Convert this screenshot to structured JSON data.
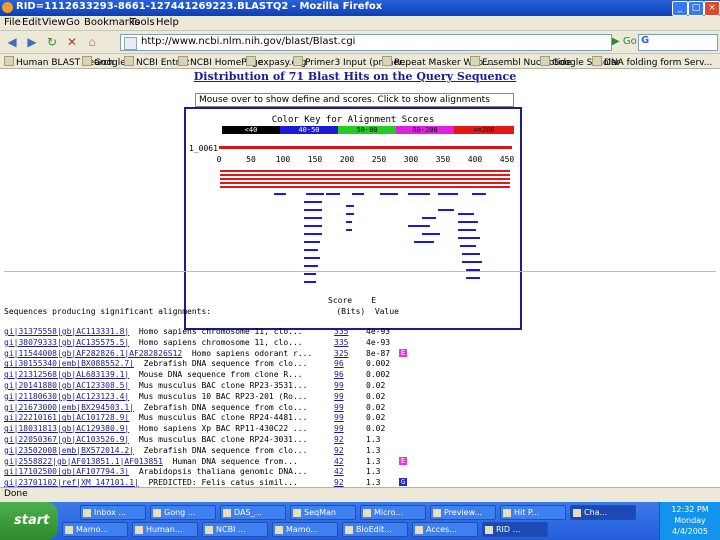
{
  "window": {
    "title": "RID=1112633293-8661-127441269223.BLASTQ2 - Mozilla Firefox",
    "controls": [
      "_",
      "□",
      "×"
    ]
  },
  "menu": [
    "File",
    "Edit",
    "View",
    "Go",
    "Bookmarks",
    "Tools",
    "Help"
  ],
  "nav": {
    "url": "http://www.ncbi.nlm.nih.gov/blast/Blast.cgi",
    "go_label": "Go",
    "search_placeholder": ""
  },
  "bookmarks": [
    "Human BLAST Search",
    "Google",
    "NCBI Entrez",
    "NCBI HomePage",
    "expasy.org",
    "Primer3 Input (primer...",
    "Repeat Masker Web ...",
    "Ensembl Nucleotide",
    "Google Scholar",
    "DNA folding form Serv..."
  ],
  "page": {
    "heading": "Distribution of 71 Blast Hits on the Query Sequence",
    "mouseover_text": "Mouse over to show define and scores. Click to show alignments",
    "key_title": "Color Key for Alignment Scores",
    "key_segments": [
      {
        "label": "<40",
        "color": "#000000"
      },
      {
        "label": "40-50",
        "color": "#1a1ad6"
      },
      {
        "label": "50-80",
        "color": "#22cc22"
      },
      {
        "label": "80-200",
        "color": "#e020e0"
      },
      {
        "label": ">=200",
        "color": "#e01818"
      }
    ],
    "query_label": "1_0061",
    "ticks": [
      "0",
      "50",
      "100",
      "150",
      "200",
      "250",
      "300",
      "350",
      "400",
      "450"
    ]
  },
  "results": {
    "header_line1": "Score    E",
    "header_line2": "Sequences producing significant alignments:                          (Bits)  Value",
    "rows": [
      {
        "acc": "gi|31375558|gb|AC113331.8|",
        "desc": "  Homo sapiens chromosome 11, clo...",
        "score": "335",
        "evalue": "4e-93",
        "badge": ""
      },
      {
        "acc": "gi|38079333|gb|AC135575.5|",
        "desc": "  Homo sapiens chromosome 11, clo...",
        "score": "335",
        "evalue": "4e-93",
        "badge": ""
      },
      {
        "acc": "gi|11544008|gb|AF282826.1|AF282826S12",
        "desc": "  Homo sapiens odorant r...",
        "score": "325",
        "evalue": "8e-87",
        "badge": "pink"
      },
      {
        "acc": "gi|30155340|emb|BX088552.7|",
        "desc": "  Zebrafish DNA sequence from clo...",
        "score": "96",
        "evalue": "0.002",
        "badge": ""
      },
      {
        "acc": "gi|21312568|gb|AL683139.1|",
        "desc": "  Mouse DNA sequence from clone R...",
        "score": "96",
        "evalue": "0.002",
        "badge": ""
      },
      {
        "acc": "gi|20141880|gb|AC123308.5|",
        "desc": "  Mus musculus BAC clone RP23-3531...",
        "score": "99",
        "evalue": "0.02",
        "badge": ""
      },
      {
        "acc": "gi|21180630|gb|AC123123.4|",
        "desc": "  Mus musculus 10 BAC RP23-201 (Ro...",
        "score": "99",
        "evalue": "0.02",
        "badge": ""
      },
      {
        "acc": "gi|21673000|emb|BX294503.1|",
        "desc": "  Zebrafish DNA sequence from clo...",
        "score": "99",
        "evalue": "0.02",
        "badge": ""
      },
      {
        "acc": "gi|22210161|gb|AC101728.9|",
        "desc": "  Mus musculus BAC clone RP24-4481...",
        "score": "99",
        "evalue": "0.02",
        "badge": ""
      },
      {
        "acc": "gi|18031813|gb|AC129380.9|",
        "desc": "  Homo sapiens Xp BAC RP11-430C22 ...",
        "score": "99",
        "evalue": "0.02",
        "badge": ""
      },
      {
        "acc": "gi|22050367|gb|AC103526.9|",
        "desc": "  Mus musculus BAC clone RP24-3031...",
        "score": "92",
        "evalue": "1.3",
        "badge": ""
      },
      {
        "acc": "gi|23502008|emb|BX572014.2|",
        "desc": "  Zebrafish DNA sequence from clo...",
        "score": "92",
        "evalue": "1.3",
        "badge": ""
      },
      {
        "acc": "gi|2558822|gb|AF013851.1|AF013851",
        "desc": "  Human DNA sequence from...",
        "score": "42",
        "evalue": "1.3",
        "badge": "pink"
      },
      {
        "acc": "gi|17102500|gb|AF107794.3|",
        "desc": "  Arabidopsis thaliana genomic DNA...",
        "score": "42",
        "evalue": "1.3",
        "badge": ""
      },
      {
        "acc": "gi|23701102|ref|XM_147101.1|",
        "desc": "  PREDICTED: Felis catus simil...",
        "score": "92",
        "evalue": "1.3",
        "badge": "blue"
      }
    ]
  },
  "status": "Done",
  "taskbar": {
    "start_label": "start",
    "items_row1": [
      "Inbox ...",
      "Gong ...",
      "DAS_...",
      "SeqMan",
      "Micro...",
      "Preview...",
      "Hit P...",
      "Cha..."
    ],
    "items_row2": [
      "Mamo...",
      "Human...",
      "NCBI ...",
      "Mamo...",
      "BioEdit...",
      "Acces...",
      "RID ..."
    ],
    "clock": "12:32 PM",
    "day": "Monday",
    "date": "4/4/2005"
  }
}
